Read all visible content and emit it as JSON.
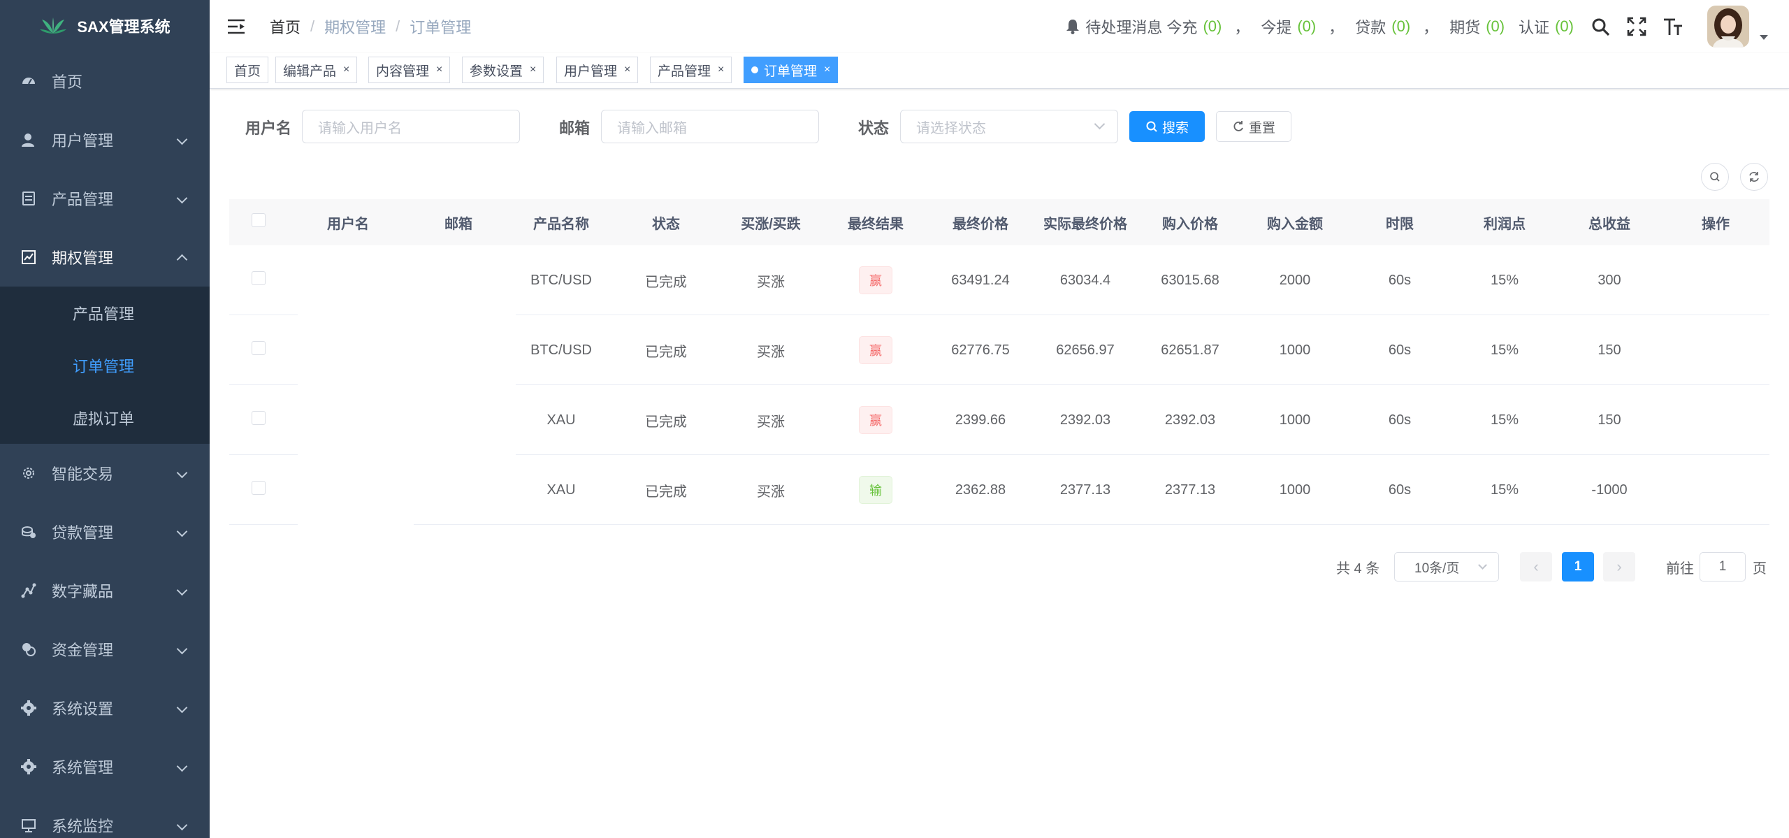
{
  "app": {
    "title": "SAX管理系统"
  },
  "sidebar": {
    "items": [
      {
        "label": "首页",
        "icon": "dashboard-icon"
      },
      {
        "label": "用户管理",
        "icon": "user-icon"
      },
      {
        "label": "产品管理",
        "icon": "document-icon"
      },
      {
        "label": "期权管理",
        "icon": "chart-icon"
      },
      {
        "label": "智能交易",
        "icon": "gear-icon"
      },
      {
        "label": "贷款管理",
        "icon": "money-icon"
      },
      {
        "label": "数字藏品",
        "icon": "nodes-icon"
      },
      {
        "label": "资金管理",
        "icon": "coins-icon"
      },
      {
        "label": "系统设置",
        "icon": "cog-icon"
      },
      {
        "label": "系统管理",
        "icon": "cog-icon"
      },
      {
        "label": "系统监控",
        "icon": "monitor-icon"
      }
    ],
    "submenu": [
      "产品管理",
      "订单管理",
      "虚拟订单"
    ]
  },
  "navbar": {
    "breadcrumb": [
      "首页",
      "期权管理",
      "订单管理"
    ],
    "notice": {
      "prefix": "待处理消息",
      "items": [
        {
          "label": "今充",
          "count": "(0)"
        },
        {
          "label": "今提",
          "count": "(0)"
        },
        {
          "label": "贷款",
          "count": "(0)"
        },
        {
          "label": "期货",
          "count": "(0)"
        },
        {
          "label": "认证",
          "count": "(0)"
        }
      ],
      "separator": "，"
    }
  },
  "tags": {
    "items": [
      "首页",
      "编辑产品",
      "内容管理",
      "参数设置",
      "用户管理",
      "产品管理",
      "订单管理"
    ],
    "close": "×",
    "active_index": 6
  },
  "search": {
    "username_label": "用户名",
    "username_placeholder": "请输入用户名",
    "email_label": "邮箱",
    "email_placeholder": "请输入邮箱",
    "status_label": "状态",
    "status_placeholder": "请选择状态",
    "search_button": "搜索",
    "reset_button": "重置"
  },
  "table": {
    "headers": [
      "用户名",
      "邮箱",
      "产品名称",
      "状态",
      "买涨/买跌",
      "最终结果",
      "最终价格",
      "实际最终价格",
      "购入价格",
      "购入金额",
      "时限",
      "利润点",
      "总收益",
      "操作"
    ],
    "rows": [
      {
        "product": "BTC/USD",
        "status": "已完成",
        "direction": "买涨",
        "result": "赢",
        "result_type": "win",
        "final_price": "63491.24",
        "actual_final_price": "63034.4",
        "buy_price": "63015.68",
        "amount": "2000",
        "duration": "60s",
        "profit_point": "15%",
        "total_profit": "300"
      },
      {
        "product": "BTC/USD",
        "status": "已完成",
        "direction": "买涨",
        "result": "赢",
        "result_type": "win",
        "final_price": "62776.75",
        "actual_final_price": "62656.97",
        "buy_price": "62651.87",
        "amount": "1000",
        "duration": "60s",
        "profit_point": "15%",
        "total_profit": "150"
      },
      {
        "product": "XAU",
        "status": "已完成",
        "direction": "买涨",
        "result": "赢",
        "result_type": "win",
        "final_price": "2399.66",
        "actual_final_price": "2392.03",
        "buy_price": "2392.03",
        "amount": "1000",
        "duration": "60s",
        "profit_point": "15%",
        "total_profit": "150"
      },
      {
        "product": "XAU",
        "status": "已完成",
        "direction": "买涨",
        "result": "输",
        "result_type": "loss",
        "final_price": "2362.88",
        "actual_final_price": "2377.13",
        "buy_price": "2377.13",
        "amount": "1000",
        "duration": "60s",
        "profit_point": "15%",
        "total_profit": "-1000"
      }
    ]
  },
  "pagination": {
    "total": "共 4 条",
    "page_size": "10条/页",
    "current_page": "1",
    "goto_prefix": "前往",
    "goto_value": "1",
    "goto_suffix": "页"
  },
  "colors": {
    "sidebar_bg": "#304156",
    "submenu_bg": "#1f2d3d",
    "accent": "#409eff",
    "primary_button": "#1890ff",
    "win": "#f56c6c",
    "loss": "#67c23a",
    "notice_count": "#67c23a"
  }
}
